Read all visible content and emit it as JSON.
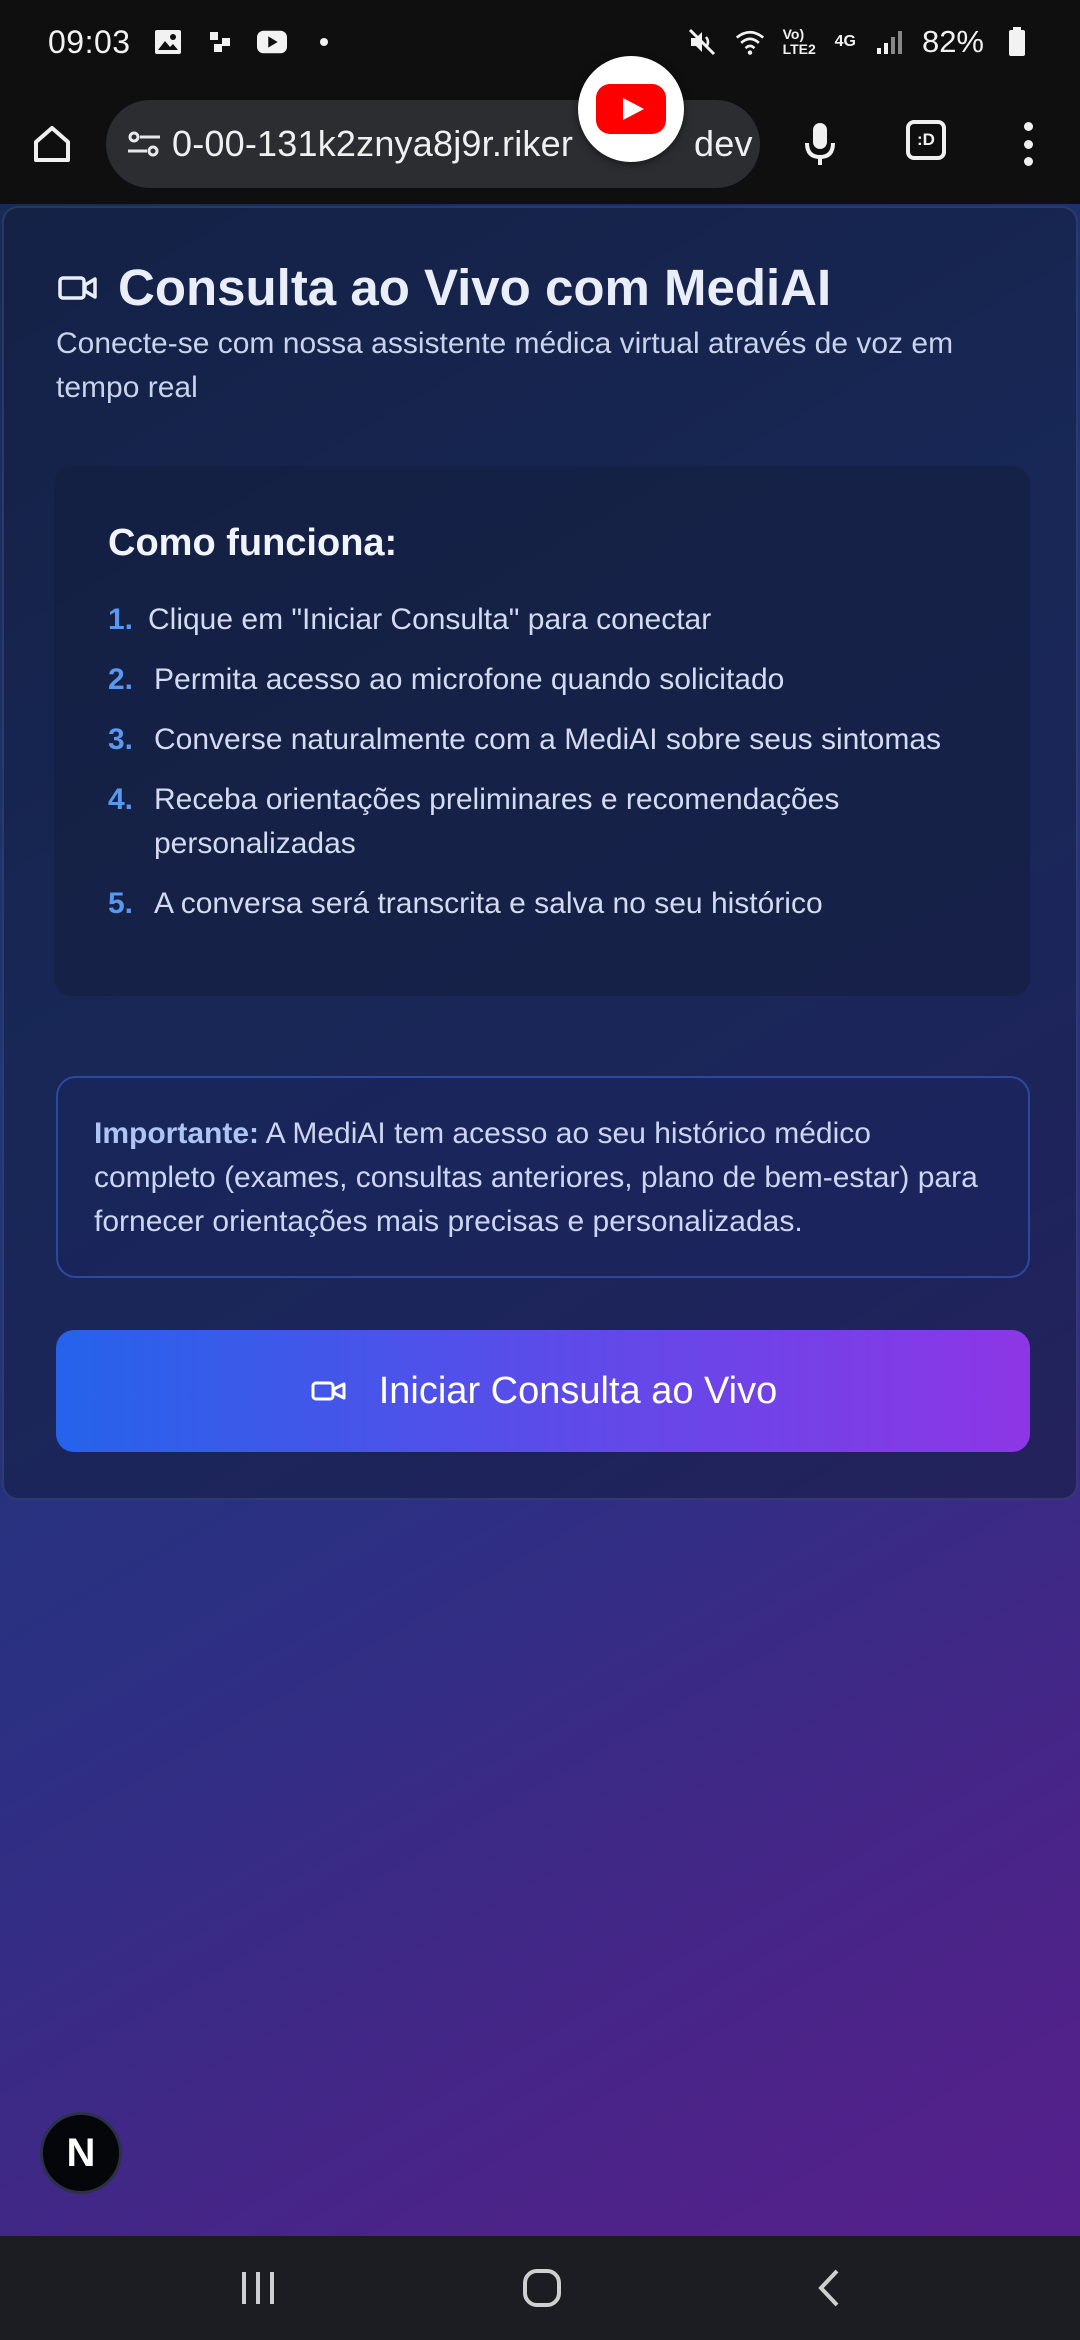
{
  "status_bar": {
    "time": "09:03",
    "battery": "82%",
    "left_icons": [
      "image-icon",
      "pinwheel-icon",
      "youtube-icon",
      "dot-icon"
    ],
    "right_icons": [
      "mute-icon",
      "wifi-icon",
      "volte-icon",
      "4g-icon",
      "signal-icon",
      "battery-icon"
    ],
    "volte_label": "Vo) LTE2",
    "network_label": "4G"
  },
  "browser": {
    "url": "0-00-131k2znya8j9r.riker",
    "url_tail": "dev",
    "tabs_label": ":D"
  },
  "card": {
    "title": "Consulta ao Vivo com MediAI",
    "subtitle": "Conecte-se com nossa assistente médica virtual através de voz em tempo real"
  },
  "how_it_works": {
    "title": "Como funciona:",
    "steps": [
      {
        "num": "1.",
        "text": "Clique em \"Iniciar Consulta\" para conectar"
      },
      {
        "num": "2.",
        "text": "Permita acesso ao microfone quando solicitado"
      },
      {
        "num": "3.",
        "text": "Converse naturalmente com a MediAI sobre seus sintomas"
      },
      {
        "num": "4.",
        "text": "Receba orientações preliminares e recomendações personalizadas"
      },
      {
        "num": "5.",
        "text": "A conversa será transcrita e salva no seu histórico"
      }
    ]
  },
  "important": {
    "label": "Importante:",
    "text": " A MediAI tem acesso ao seu histórico médico completo (exames, consultas anteriores, plano de bem-estar) para fornecer orientações mais precisas e personalizadas."
  },
  "start_button": {
    "label": "Iniciar Consulta ao Vivo"
  },
  "badge": {
    "letter": "N"
  },
  "colors": {
    "accent_blue": "#2563eb",
    "accent_purple": "#8d36e6",
    "step_number": "#5a98f0"
  }
}
